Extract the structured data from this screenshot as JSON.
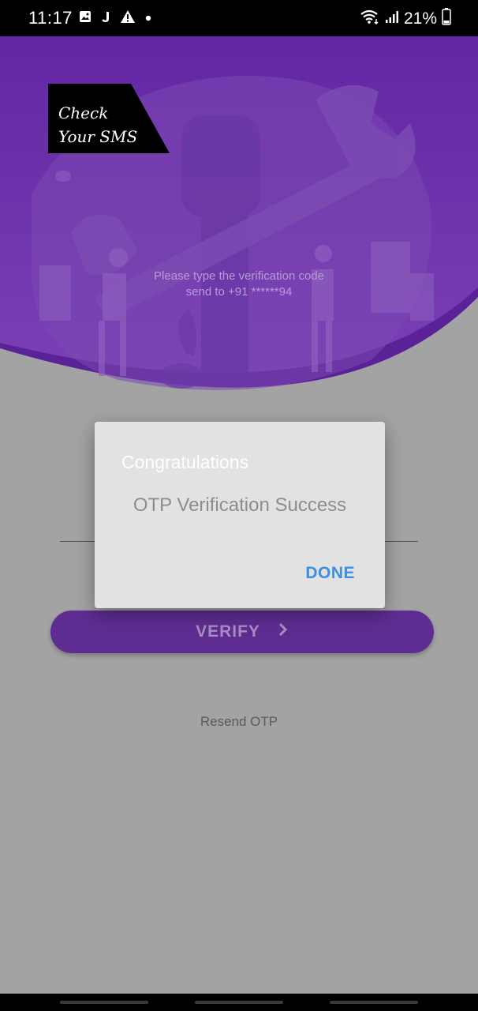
{
  "status_bar": {
    "time": "11:17",
    "battery": "21%",
    "icons": [
      "gallery-icon",
      "j-app-icon",
      "warning-icon",
      "dot-icon",
      "wifi-icon",
      "signal-icon",
      "battery-icon"
    ]
  },
  "header": {
    "badge_text": "Check\nYour SMS",
    "prompt": "Please type the verification code send to +91 ******94"
  },
  "verify_button": {
    "label": "VERIFY",
    "icon": "chevron-right-icon"
  },
  "resend": {
    "label": "Resend OTP"
  },
  "dialog": {
    "title": "Congratulations",
    "message": "OTP Verification Success",
    "action": "DONE"
  },
  "colors": {
    "accent": "#5e2d91",
    "header_purple": "#6a2fa6",
    "dialog_action": "#3d8fe0",
    "scrim": "#a3a3a3"
  }
}
